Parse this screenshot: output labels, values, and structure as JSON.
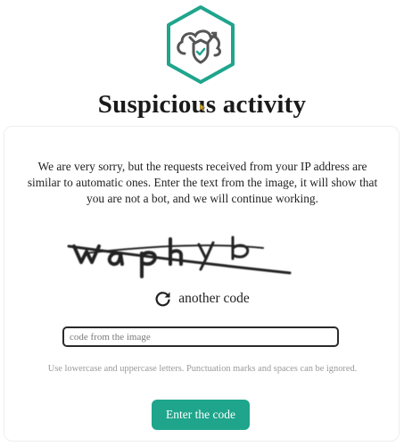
{
  "header": {
    "logo_icon": "cloud-shield-icon",
    "title": "Suspicious activity"
  },
  "card": {
    "message": "We are very sorry, but the requests received from your IP address are similar to automatic ones. Enter the text from the image, it will show that you are not a bot, and we will continue working.",
    "captcha_icon": "captcha-image",
    "refresh_icon": "refresh-icon",
    "another_code_label": "another code",
    "code_input": {
      "placeholder": "code from the image",
      "value": ""
    },
    "hint": "Use lowercase and uppercase letters. Punctuation marks and spaces can be ignored.",
    "submit_label": "Enter the code"
  },
  "colors": {
    "accent": "#1fa58c",
    "logo_stroke": "#1fa58c",
    "text": "#1a1a1a",
    "hint": "#9a9a9a"
  }
}
